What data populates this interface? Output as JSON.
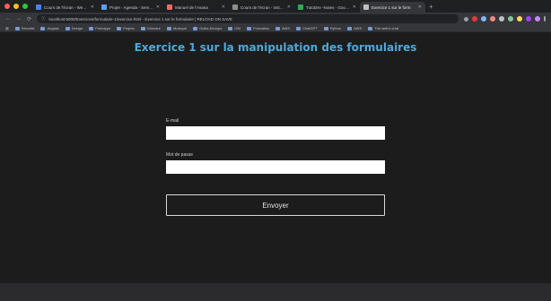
{
  "colors": {
    "accent_title": "#4fa9d9",
    "page_bg": "#1c1c1c",
    "traffic": [
      "#ff5f57",
      "#febc2e",
      "#28c840"
    ]
  },
  "tabs": [
    {
      "title": "Cours de l'écran - Website el...",
      "favicon": "#4285f4",
      "active": false
    },
    {
      "title": "Projet - Agenda - Semaine ...",
      "favicon": "#5f9ef0",
      "active": false
    },
    {
      "title": "Manuel de l'Asana",
      "favicon": "#f06a6a",
      "active": false
    },
    {
      "title": "Cours de l'écran - instruct...",
      "favicon": "#8e8e8e",
      "active": false
    },
    {
      "title": "TutoDev -Notes - Google s...",
      "favicon": "#34a853",
      "active": false
    },
    {
      "title": "Exercice 1 sur le form",
      "favicon": "#bdc1c6",
      "active": true
    }
  ],
  "toolbar": {
    "url": "localhost:5000/Exercices/formulaire-1/exercice.html - Exercice 1 sur le formulaire | RELOAD ON SAVE"
  },
  "bookmarks": [
    "Sécurité",
    "Anglais",
    "Design",
    "Prototype",
    "Projets",
    "Grimoire",
    "Musique",
    "Outils-Devops",
    "OSI",
    "Formation",
    "AWS",
    "ChatGPT",
    "Python",
    "AWS",
    "The web's chat"
  ],
  "page": {
    "title": "Exercice 1 sur la manipulation des formulaires",
    "email_label": "E-mail",
    "email_value": "",
    "password_label": "Mot de passe",
    "password_value": "",
    "submit_label": "Envoyer"
  }
}
